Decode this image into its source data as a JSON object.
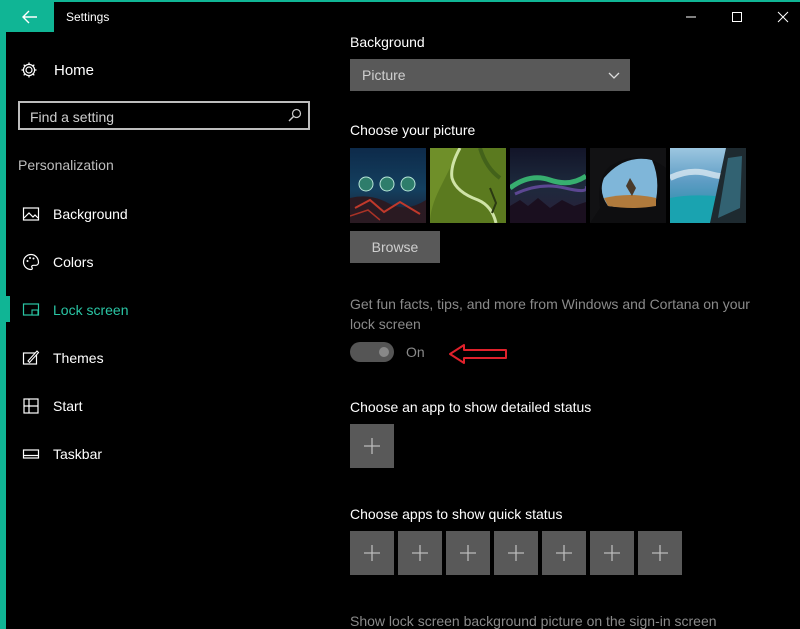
{
  "window": {
    "title": "Settings",
    "accent_color": "#10b595",
    "controls": [
      "minimize-icon",
      "maximize-icon",
      "close-icon"
    ]
  },
  "sidebar": {
    "home_label": "Home",
    "search_placeholder": "Find a setting",
    "section": "Personalization",
    "items": [
      {
        "label": "Background",
        "icon": "picture-icon"
      },
      {
        "label": "Colors",
        "icon": "palette-icon"
      },
      {
        "label": "Lock screen",
        "icon": "lock-screen-icon",
        "active": true
      },
      {
        "label": "Themes",
        "icon": "themes-icon"
      },
      {
        "label": "Start",
        "icon": "start-icon"
      },
      {
        "label": "Taskbar",
        "icon": "taskbar-icon"
      }
    ]
  },
  "main": {
    "background_heading": "Background",
    "background_value": "Picture",
    "choose_picture_heading": "Choose your picture",
    "browse_label": "Browse",
    "fun_facts_text": "Get fun facts, tips, and more from Windows and Cortana on your lock screen",
    "toggle_state": "On",
    "detailed_status_heading": "Choose an app to show detailed status",
    "quick_status_heading": "Choose apps to show quick status",
    "quick_status_slots": 7,
    "signin_text": "Show lock screen background picture on the sign-in screen"
  }
}
